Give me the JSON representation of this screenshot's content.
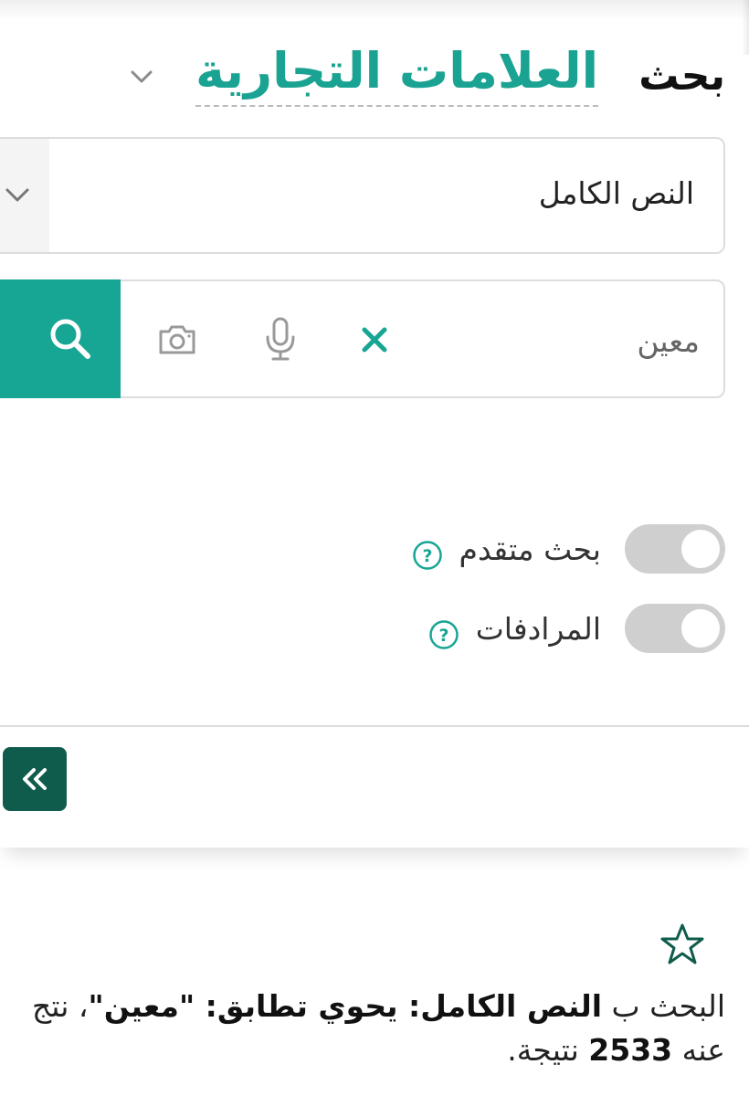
{
  "header": {
    "title_static": "بحث",
    "title_dropdown": "العلامات التجارية"
  },
  "search_type": {
    "selected": "النص الكامل"
  },
  "search": {
    "value": "معين"
  },
  "options": {
    "advanced_label": "بحث متقدم",
    "synonyms_label": "المرادفات"
  },
  "result": {
    "prefix": "البحث ب ",
    "mode": "النص الكامل:",
    "middle1": " يحوي تطابق: ",
    "term": "\"معين\"",
    "middle2": "، نتج عنه ",
    "count": "2533",
    "suffix": " نتيجة."
  },
  "colors": {
    "accent": "#17a594",
    "dark_accent": "#0f5c4d",
    "toggle_off": "#cfcfcf"
  },
  "icons": [
    "chevron-down-icon",
    "search-icon",
    "camera-icon",
    "microphone-icon",
    "close-icon",
    "help-icon",
    "double-chevron-left-icon",
    "star-icon"
  ]
}
